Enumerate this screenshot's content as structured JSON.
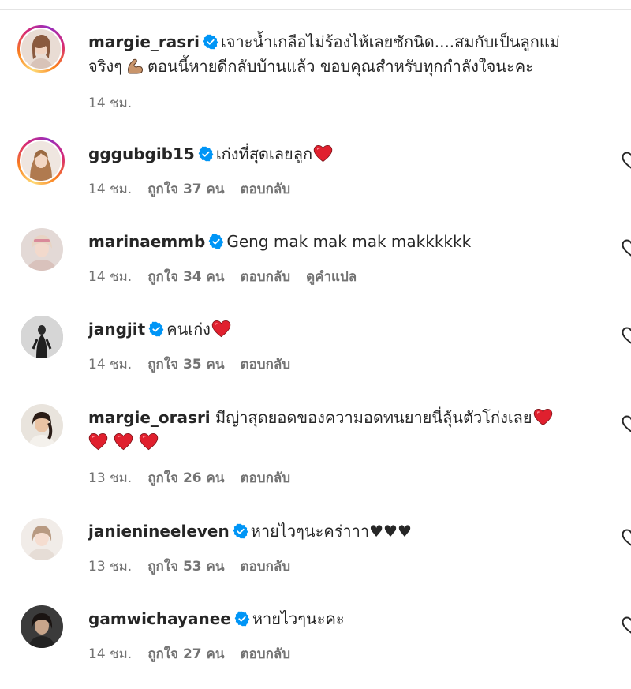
{
  "comments": [
    {
      "username": "margie_rasri",
      "verified": true,
      "text_line1": "เจาะน้ำเกลือไม่ร้องไห้เลยซักนิด....สมกับเป็นลูกแม่",
      "text_line2_pre": "จริงๆ",
      "text_line2_post": "ตอนนี้หายดีกลับบ้านแล้ว ขอบคุณสำหรับทุกกำลังใจนะคะ",
      "time": "14 ชม."
    },
    {
      "username": "gggubgib15",
      "verified": true,
      "text": "เก่งที่สุดเลยลูก",
      "time": "14 ชม.",
      "likes": "ถูกใจ 37 คน",
      "reply": "ตอบกลับ"
    },
    {
      "username": "marinaemmb",
      "verified": true,
      "text": "Geng mak mak mak makkkkkk",
      "time": "14 ชม.",
      "likes": "ถูกใจ 34 คน",
      "reply": "ตอบกลับ",
      "translate": "ดูคำแปล"
    },
    {
      "username": "jangjit",
      "verified": true,
      "text": "คนเก่ง",
      "time": "14 ชม.",
      "likes": "ถูกใจ 35 คน",
      "reply": "ตอบกลับ"
    },
    {
      "username": "margie_orasri",
      "verified": false,
      "text": "มีญ่าสุดยอดของความอดทนยายนี่ลุ้นตัวโก่งเลย",
      "time": "13 ชม.",
      "likes": "ถูกใจ 26 คน",
      "reply": "ตอบกลับ"
    },
    {
      "username": "janienineeleven",
      "verified": true,
      "text": "หายไวๆนะคร่าาา♥♥♥",
      "time": "13 ชม.",
      "likes": "ถูกใจ 53 คน",
      "reply": "ตอบกลับ"
    },
    {
      "username": "gamwichayanee",
      "verified": true,
      "text": "หายไวๆนะคะ",
      "time": "14 ชม.",
      "likes": "ถูกใจ 27 คน",
      "reply": "ตอบกลับ"
    }
  ],
  "colors": {
    "verified_blue": "#0095f6",
    "heart_red": "#e0202e",
    "meta_gray": "#737373",
    "text": "#262626"
  }
}
